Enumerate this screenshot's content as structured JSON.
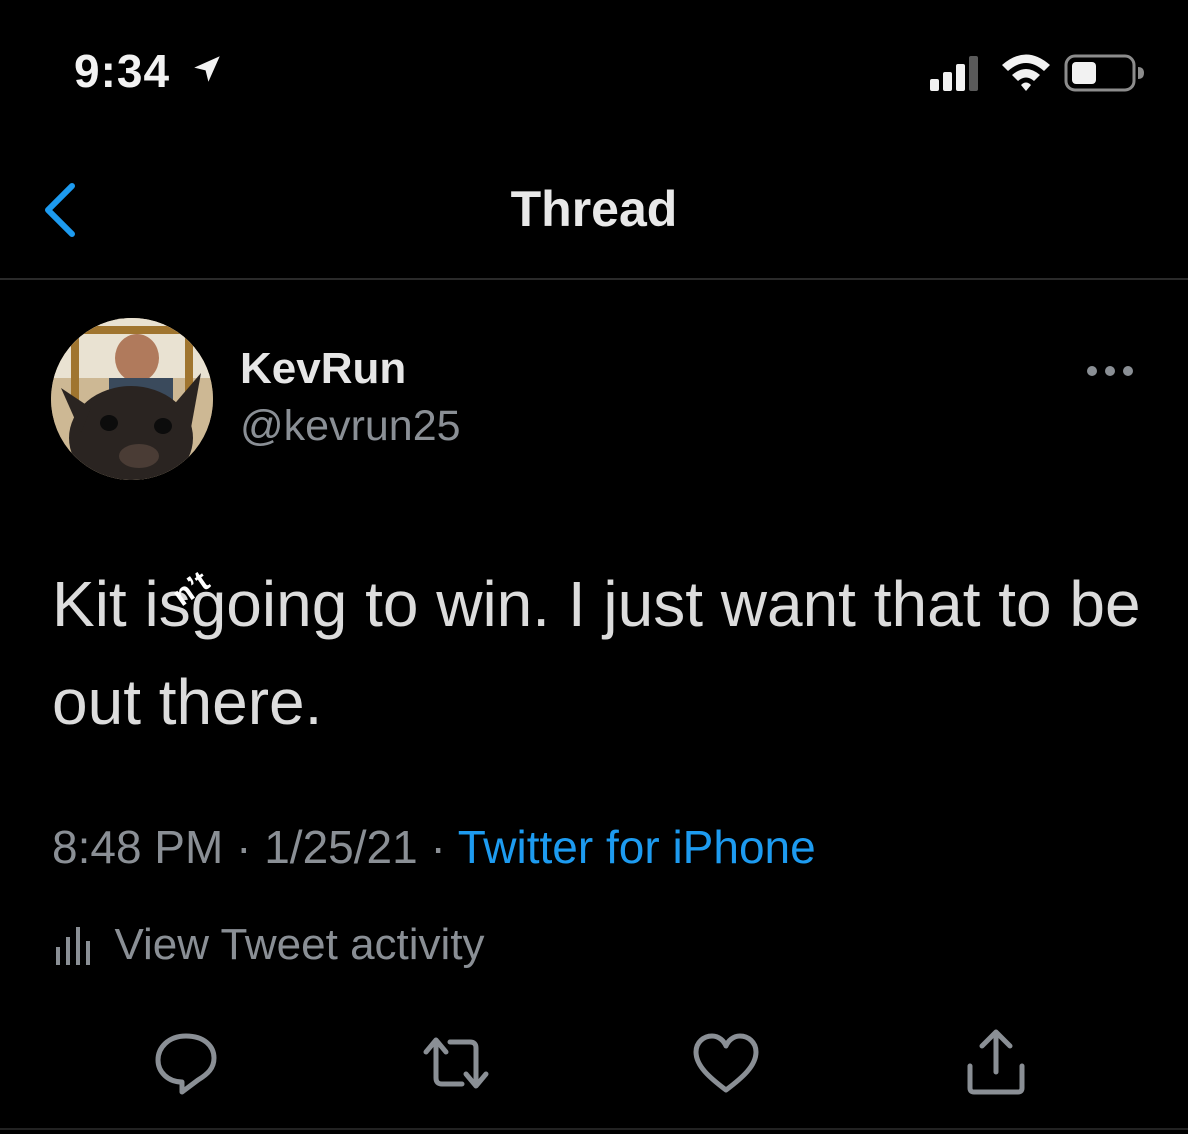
{
  "status_bar": {
    "time": "9:34",
    "icons": [
      "location-arrow-icon",
      "cellular-signal-icon",
      "wifi-icon",
      "battery-icon"
    ]
  },
  "header": {
    "title": "Thread",
    "back_icon": "chevron-left-icon"
  },
  "tweet": {
    "author_name": "KevRun",
    "author_handle": "@kevrun25",
    "text_before": "Kit is",
    "inserted_mark": "n’t",
    "text_after": "going to win. I just want that to be out there.",
    "time": "8:48 PM",
    "date": "1/25/21",
    "separator": "·",
    "source": "Twitter for iPhone",
    "activity_label": "View Tweet activity"
  },
  "actions": [
    "reply-icon",
    "retweet-icon",
    "like-icon",
    "share-icon"
  ],
  "colors": {
    "background": "#000000",
    "accent": "#1d9bf0",
    "secondary_text": "#8a8f95",
    "primary_text": "#dcdcdc"
  }
}
